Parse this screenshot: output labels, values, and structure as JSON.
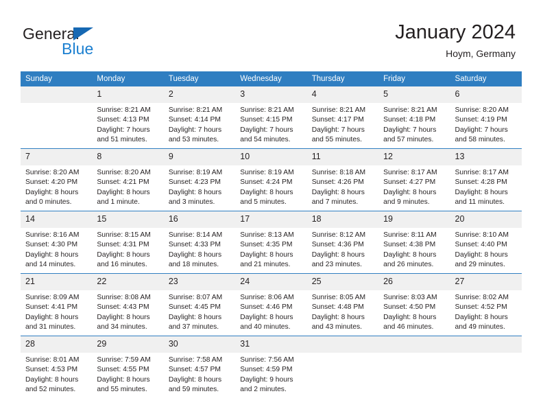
{
  "brand": {
    "name_part1": "General",
    "name_part2": "Blue",
    "accent_color": "#1b7fd0",
    "triangle_color": "#1668b3"
  },
  "header": {
    "title": "January 2024",
    "location": "Hoym, Germany"
  },
  "calendar": {
    "header_bg": "#2f7ec1",
    "header_text_color": "#ffffff",
    "daynum_bg": "#f0f0f0",
    "weekdays": [
      "Sunday",
      "Monday",
      "Tuesday",
      "Wednesday",
      "Thursday",
      "Friday",
      "Saturday"
    ],
    "weeks": [
      [
        {
          "day": "",
          "sunrise": "",
          "sunset": "",
          "daylight_line1": "",
          "daylight_line2": ""
        },
        {
          "day": "1",
          "sunrise": "Sunrise: 8:21 AM",
          "sunset": "Sunset: 4:13 PM",
          "daylight_line1": "Daylight: 7 hours",
          "daylight_line2": "and 51 minutes."
        },
        {
          "day": "2",
          "sunrise": "Sunrise: 8:21 AM",
          "sunset": "Sunset: 4:14 PM",
          "daylight_line1": "Daylight: 7 hours",
          "daylight_line2": "and 53 minutes."
        },
        {
          "day": "3",
          "sunrise": "Sunrise: 8:21 AM",
          "sunset": "Sunset: 4:15 PM",
          "daylight_line1": "Daylight: 7 hours",
          "daylight_line2": "and 54 minutes."
        },
        {
          "day": "4",
          "sunrise": "Sunrise: 8:21 AM",
          "sunset": "Sunset: 4:17 PM",
          "daylight_line1": "Daylight: 7 hours",
          "daylight_line2": "and 55 minutes."
        },
        {
          "day": "5",
          "sunrise": "Sunrise: 8:21 AM",
          "sunset": "Sunset: 4:18 PM",
          "daylight_line1": "Daylight: 7 hours",
          "daylight_line2": "and 57 minutes."
        },
        {
          "day": "6",
          "sunrise": "Sunrise: 8:20 AM",
          "sunset": "Sunset: 4:19 PM",
          "daylight_line1": "Daylight: 7 hours",
          "daylight_line2": "and 58 minutes."
        }
      ],
      [
        {
          "day": "7",
          "sunrise": "Sunrise: 8:20 AM",
          "sunset": "Sunset: 4:20 PM",
          "daylight_line1": "Daylight: 8 hours",
          "daylight_line2": "and 0 minutes."
        },
        {
          "day": "8",
          "sunrise": "Sunrise: 8:20 AM",
          "sunset": "Sunset: 4:21 PM",
          "daylight_line1": "Daylight: 8 hours",
          "daylight_line2": "and 1 minute."
        },
        {
          "day": "9",
          "sunrise": "Sunrise: 8:19 AM",
          "sunset": "Sunset: 4:23 PM",
          "daylight_line1": "Daylight: 8 hours",
          "daylight_line2": "and 3 minutes."
        },
        {
          "day": "10",
          "sunrise": "Sunrise: 8:19 AM",
          "sunset": "Sunset: 4:24 PM",
          "daylight_line1": "Daylight: 8 hours",
          "daylight_line2": "and 5 minutes."
        },
        {
          "day": "11",
          "sunrise": "Sunrise: 8:18 AM",
          "sunset": "Sunset: 4:26 PM",
          "daylight_line1": "Daylight: 8 hours",
          "daylight_line2": "and 7 minutes."
        },
        {
          "day": "12",
          "sunrise": "Sunrise: 8:17 AM",
          "sunset": "Sunset: 4:27 PM",
          "daylight_line1": "Daylight: 8 hours",
          "daylight_line2": "and 9 minutes."
        },
        {
          "day": "13",
          "sunrise": "Sunrise: 8:17 AM",
          "sunset": "Sunset: 4:28 PM",
          "daylight_line1": "Daylight: 8 hours",
          "daylight_line2": "and 11 minutes."
        }
      ],
      [
        {
          "day": "14",
          "sunrise": "Sunrise: 8:16 AM",
          "sunset": "Sunset: 4:30 PM",
          "daylight_line1": "Daylight: 8 hours",
          "daylight_line2": "and 14 minutes."
        },
        {
          "day": "15",
          "sunrise": "Sunrise: 8:15 AM",
          "sunset": "Sunset: 4:31 PM",
          "daylight_line1": "Daylight: 8 hours",
          "daylight_line2": "and 16 minutes."
        },
        {
          "day": "16",
          "sunrise": "Sunrise: 8:14 AM",
          "sunset": "Sunset: 4:33 PM",
          "daylight_line1": "Daylight: 8 hours",
          "daylight_line2": "and 18 minutes."
        },
        {
          "day": "17",
          "sunrise": "Sunrise: 8:13 AM",
          "sunset": "Sunset: 4:35 PM",
          "daylight_line1": "Daylight: 8 hours",
          "daylight_line2": "and 21 minutes."
        },
        {
          "day": "18",
          "sunrise": "Sunrise: 8:12 AM",
          "sunset": "Sunset: 4:36 PM",
          "daylight_line1": "Daylight: 8 hours",
          "daylight_line2": "and 23 minutes."
        },
        {
          "day": "19",
          "sunrise": "Sunrise: 8:11 AM",
          "sunset": "Sunset: 4:38 PM",
          "daylight_line1": "Daylight: 8 hours",
          "daylight_line2": "and 26 minutes."
        },
        {
          "day": "20",
          "sunrise": "Sunrise: 8:10 AM",
          "sunset": "Sunset: 4:40 PM",
          "daylight_line1": "Daylight: 8 hours",
          "daylight_line2": "and 29 minutes."
        }
      ],
      [
        {
          "day": "21",
          "sunrise": "Sunrise: 8:09 AM",
          "sunset": "Sunset: 4:41 PM",
          "daylight_line1": "Daylight: 8 hours",
          "daylight_line2": "and 31 minutes."
        },
        {
          "day": "22",
          "sunrise": "Sunrise: 8:08 AM",
          "sunset": "Sunset: 4:43 PM",
          "daylight_line1": "Daylight: 8 hours",
          "daylight_line2": "and 34 minutes."
        },
        {
          "day": "23",
          "sunrise": "Sunrise: 8:07 AM",
          "sunset": "Sunset: 4:45 PM",
          "daylight_line1": "Daylight: 8 hours",
          "daylight_line2": "and 37 minutes."
        },
        {
          "day": "24",
          "sunrise": "Sunrise: 8:06 AM",
          "sunset": "Sunset: 4:46 PM",
          "daylight_line1": "Daylight: 8 hours",
          "daylight_line2": "and 40 minutes."
        },
        {
          "day": "25",
          "sunrise": "Sunrise: 8:05 AM",
          "sunset": "Sunset: 4:48 PM",
          "daylight_line1": "Daylight: 8 hours",
          "daylight_line2": "and 43 minutes."
        },
        {
          "day": "26",
          "sunrise": "Sunrise: 8:03 AM",
          "sunset": "Sunset: 4:50 PM",
          "daylight_line1": "Daylight: 8 hours",
          "daylight_line2": "and 46 minutes."
        },
        {
          "day": "27",
          "sunrise": "Sunrise: 8:02 AM",
          "sunset": "Sunset: 4:52 PM",
          "daylight_line1": "Daylight: 8 hours",
          "daylight_line2": "and 49 minutes."
        }
      ],
      [
        {
          "day": "28",
          "sunrise": "Sunrise: 8:01 AM",
          "sunset": "Sunset: 4:53 PM",
          "daylight_line1": "Daylight: 8 hours",
          "daylight_line2": "and 52 minutes."
        },
        {
          "day": "29",
          "sunrise": "Sunrise: 7:59 AM",
          "sunset": "Sunset: 4:55 PM",
          "daylight_line1": "Daylight: 8 hours",
          "daylight_line2": "and 55 minutes."
        },
        {
          "day": "30",
          "sunrise": "Sunrise: 7:58 AM",
          "sunset": "Sunset: 4:57 PM",
          "daylight_line1": "Daylight: 8 hours",
          "daylight_line2": "and 59 minutes."
        },
        {
          "day": "31",
          "sunrise": "Sunrise: 7:56 AM",
          "sunset": "Sunset: 4:59 PM",
          "daylight_line1": "Daylight: 9 hours",
          "daylight_line2": "and 2 minutes."
        },
        {
          "day": "",
          "sunrise": "",
          "sunset": "",
          "daylight_line1": "",
          "daylight_line2": ""
        },
        {
          "day": "",
          "sunrise": "",
          "sunset": "",
          "daylight_line1": "",
          "daylight_line2": ""
        },
        {
          "day": "",
          "sunrise": "",
          "sunset": "",
          "daylight_line1": "",
          "daylight_line2": ""
        }
      ]
    ]
  }
}
